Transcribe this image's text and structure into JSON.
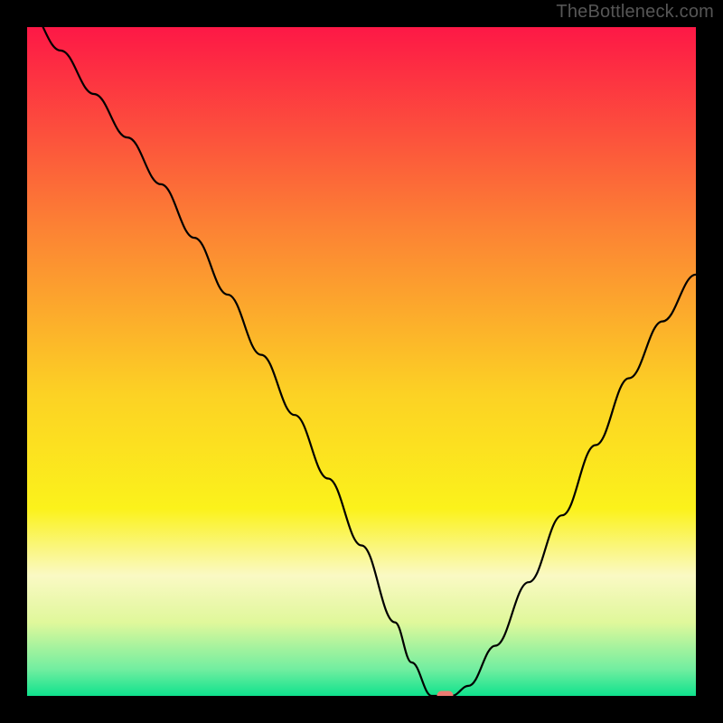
{
  "attribution": "TheBottleneck.com",
  "chart_data": {
    "type": "line",
    "title": "",
    "xlabel": "",
    "ylabel": "",
    "xlim": [
      0,
      1
    ],
    "ylim": [
      0,
      1
    ],
    "x": [
      0.0,
      0.05,
      0.1,
      0.15,
      0.2,
      0.25,
      0.3,
      0.35,
      0.4,
      0.45,
      0.5,
      0.55,
      0.575,
      0.605,
      0.635,
      0.66,
      0.7,
      0.75,
      0.8,
      0.85,
      0.9,
      0.95,
      1.0
    ],
    "values": [
      1.03,
      0.965,
      0.9,
      0.835,
      0.765,
      0.685,
      0.6,
      0.51,
      0.42,
      0.325,
      0.225,
      0.11,
      0.05,
      0.0,
      0.0,
      0.015,
      0.075,
      0.17,
      0.27,
      0.375,
      0.475,
      0.56,
      0.63
    ],
    "marker": {
      "x": 0.625,
      "y": 0.0
    },
    "background_gradient": {
      "stops": [
        {
          "offset": 0.0,
          "color": "#fd1846"
        },
        {
          "offset": 0.3,
          "color": "#fc8234"
        },
        {
          "offset": 0.55,
          "color": "#fcd224"
        },
        {
          "offset": 0.72,
          "color": "#fbf21b"
        },
        {
          "offset": 0.82,
          "color": "#faf9c4"
        },
        {
          "offset": 0.89,
          "color": "#e0f89b"
        },
        {
          "offset": 0.96,
          "color": "#72eea0"
        },
        {
          "offset": 1.0,
          "color": "#0fe28d"
        }
      ]
    }
  }
}
